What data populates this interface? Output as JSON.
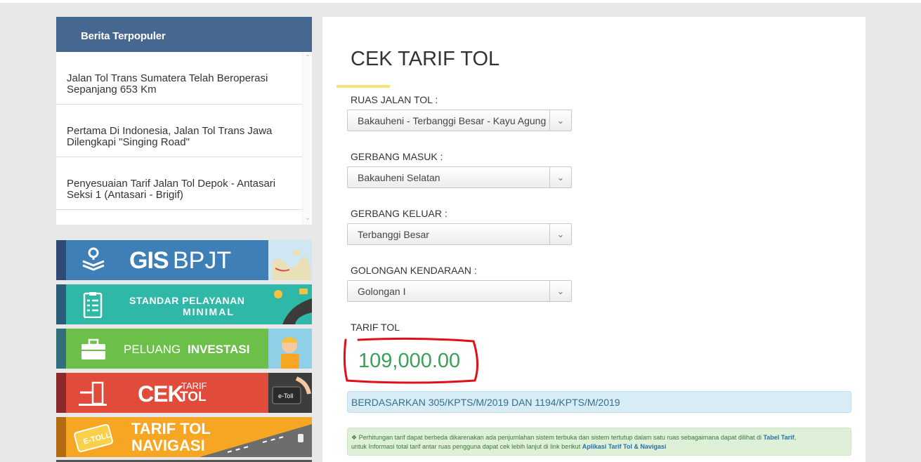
{
  "news": {
    "header": "Berita Terpopuler",
    "items": [
      {
        "line1": "Jalan Tol Trans Sumatera Telah Beroperasi",
        "line2": "Sepanjang 653 Km"
      },
      {
        "line1": "Pertama Di Indonesia, Jalan Tol Trans Jawa",
        "line2": "Dilengkapi \"Singing Road\""
      },
      {
        "line1": "Penyesuaian Tarif Jalan Tol Depok - Antasari",
        "line2": "Seksi 1 (Antasari - Brigif)"
      }
    ]
  },
  "banners": {
    "gis": {
      "bold": "GIS",
      "light": "BPJT",
      "icon": "layers-pin-icon"
    },
    "spm": {
      "line1_a": "STANDAR ",
      "line1_b": "PELAYANAN",
      "line2": "MINIMAL",
      "icon": "checklist-icon"
    },
    "investasi": {
      "light": "PELUANG",
      "bold": "INVESTASI",
      "icon": "briefcase-icon"
    },
    "cektarif": {
      "big": "CEK",
      "small1": "TARIF",
      "small2": "TOL",
      "icon": "toll-gate-icon"
    },
    "navigasi": {
      "line1": "TARIF TOL",
      "line2": "NAVIGASI",
      "card": "E-TOLL"
    }
  },
  "form": {
    "title": "CEK TARIF TOL",
    "ruas_label": "RUAS JALAN TOL :",
    "ruas_value": "Bakauheni - Terbanggi Besar - Kayu Agung",
    "masuk_label": "GERBANG MASUK :",
    "masuk_value": "Bakauheni Selatan",
    "keluar_label": "GERBANG KELUAR :",
    "keluar_value": "Terbanggi Besar",
    "golongan_label": "GOLONGAN KENDARAAN :",
    "golongan_value": "Golongan I",
    "tarif_label": "TARIF TOL",
    "tarif_value": "109,000.00",
    "basis": "BERDASARKAN 305/KPTS/M/2019 DAN 1194/KPTS/M/2019",
    "note_a": "Perhitungan tarif dapat berbeda dikarenakan ada penjumlahan sistem terbuka dan sistem tertutup dalam satu ruas sebagaimana dapat dilihat di ",
    "note_link1": "Tabel Tarif",
    "note_b": "untuk Informasi total tarif antar ruas pengguna dapat cek lebih lanjut di link berikut ",
    "note_link2": "Aplikasi Tarif Tol & Navigasi"
  },
  "colors": {
    "header": "#46678f",
    "tarif_green": "#3aa05a",
    "annotation_red": "#e0101a",
    "accent_yellow": "#f5e27a"
  }
}
